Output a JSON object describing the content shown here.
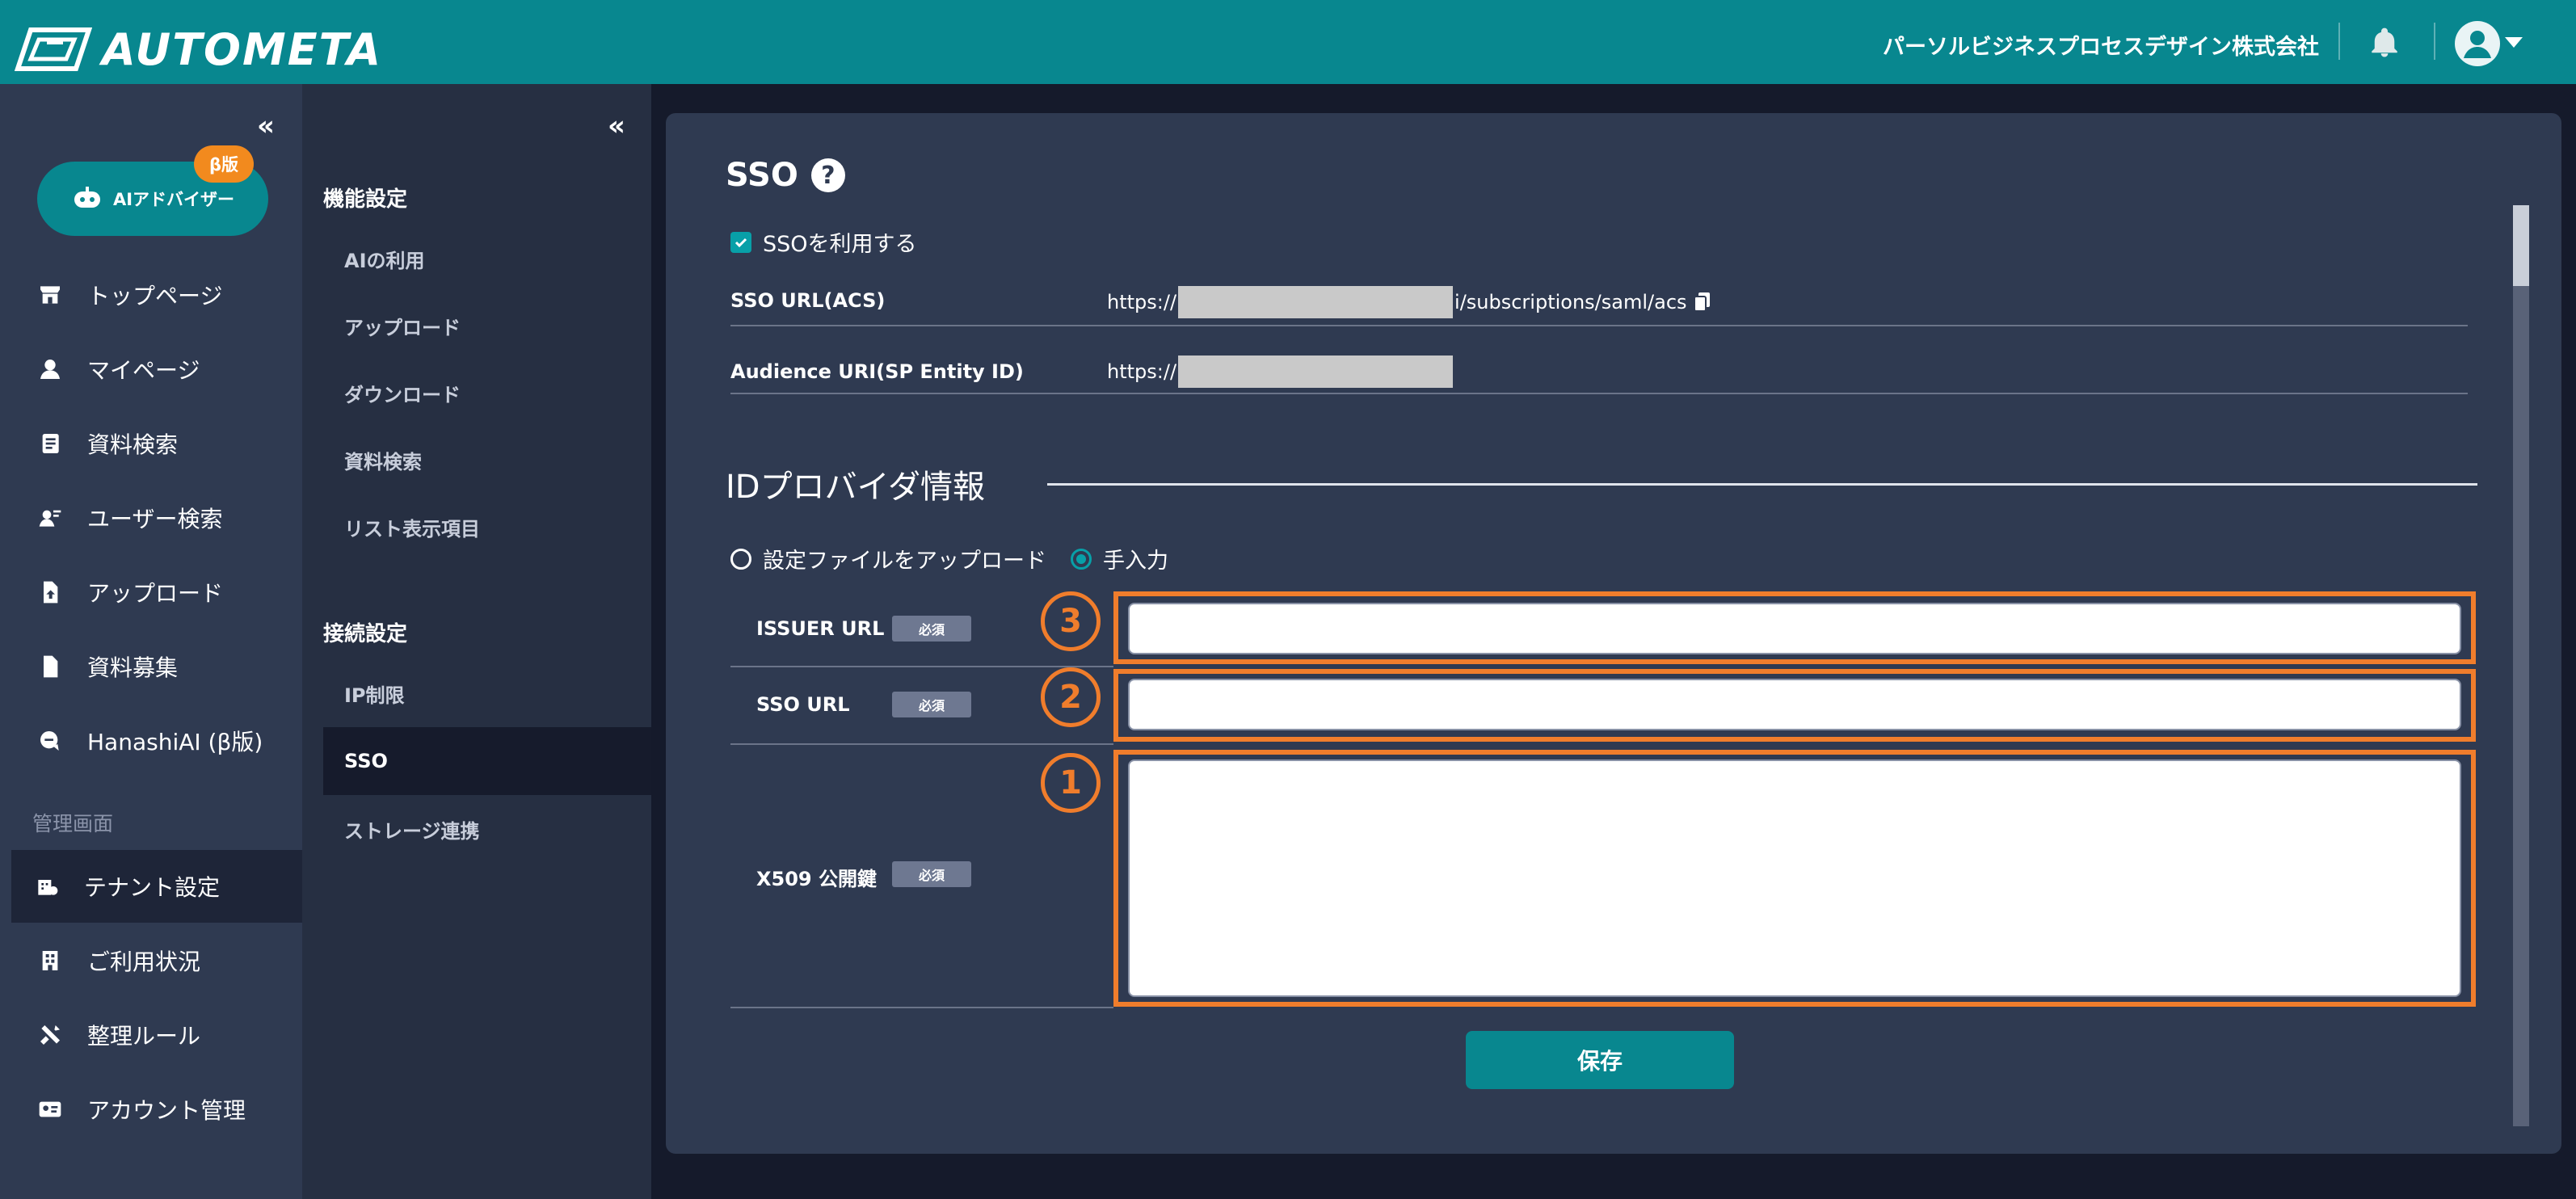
{
  "header": {
    "brand": "AUTOMETA",
    "company": "パーソルビジネスプロセスデザイン株式会社",
    "bell_icon": "bell-icon",
    "avatar_icon": "user-avatar-icon"
  },
  "sidebar": {
    "collapse_glyph": "«",
    "ai_button": {
      "label": "AIアドバイザー",
      "badge": "β版"
    },
    "items": [
      {
        "label": "トップページ",
        "icon": "store-icon"
      },
      {
        "label": "マイページ",
        "icon": "person-icon"
      },
      {
        "label": "資料検索",
        "icon": "document-search-icon"
      },
      {
        "label": "ユーザー検索",
        "icon": "user-search-icon"
      },
      {
        "label": "アップロード",
        "icon": "upload-file-icon"
      },
      {
        "label": "資料募集",
        "icon": "file-icon"
      },
      {
        "label": "HanashiAI (β版)",
        "icon": "chat-icon"
      }
    ],
    "admin_label": "管理画面",
    "admin_items": [
      {
        "label": "テナント設定",
        "icon": "building-settings-icon",
        "active": true
      },
      {
        "label": "ご利用状況",
        "icon": "building-icon"
      },
      {
        "label": "整理ルール",
        "icon": "tools-icon"
      },
      {
        "label": "アカウント管理",
        "icon": "id-card-icon"
      }
    ]
  },
  "subsidebar": {
    "collapse_glyph": "«",
    "group1": {
      "heading": "機能設定",
      "items": [
        "AIの利用",
        "アップロード",
        "ダウンロード",
        "資料検索",
        "リスト表示項目"
      ]
    },
    "group2": {
      "heading": "接続設定",
      "items": [
        "IP制限",
        "SSO",
        "ストレージ連携"
      ],
      "active": "SSO"
    }
  },
  "content": {
    "title": "SSO",
    "help_glyph": "?",
    "use_sso_label": "SSOを利用する",
    "use_sso_checked": true,
    "rows": [
      {
        "label": "SSO URL(ACS)",
        "value_prefix": "https://",
        "value_suffix": "i/subscriptions/saml/acs"
      },
      {
        "label": "Audience URI(SP Entity ID)",
        "value_prefix": "https://",
        "value_suffix": ""
      }
    ],
    "idp_title": "IDプロバイダ情報",
    "radio_upload": "設定ファイルをアップロード",
    "radio_manual": "手入力",
    "selected_radio": "手入力",
    "fields": [
      {
        "label": "ISSUER URL",
        "required": "必須",
        "badge": "3",
        "value": ""
      },
      {
        "label": "SSO URL",
        "required": "必須",
        "badge": "2",
        "value": ""
      },
      {
        "label": "X509 公開鍵",
        "required": "必須",
        "badge": "1",
        "value": ""
      }
    ],
    "save_label": "保存"
  },
  "colors": {
    "header": "#08878f",
    "sidebar": "#2f3a51",
    "subsidebar": "#262f42",
    "background": "#151a2b",
    "highlight": "#f07d2c",
    "accent": "#08a0a8"
  }
}
